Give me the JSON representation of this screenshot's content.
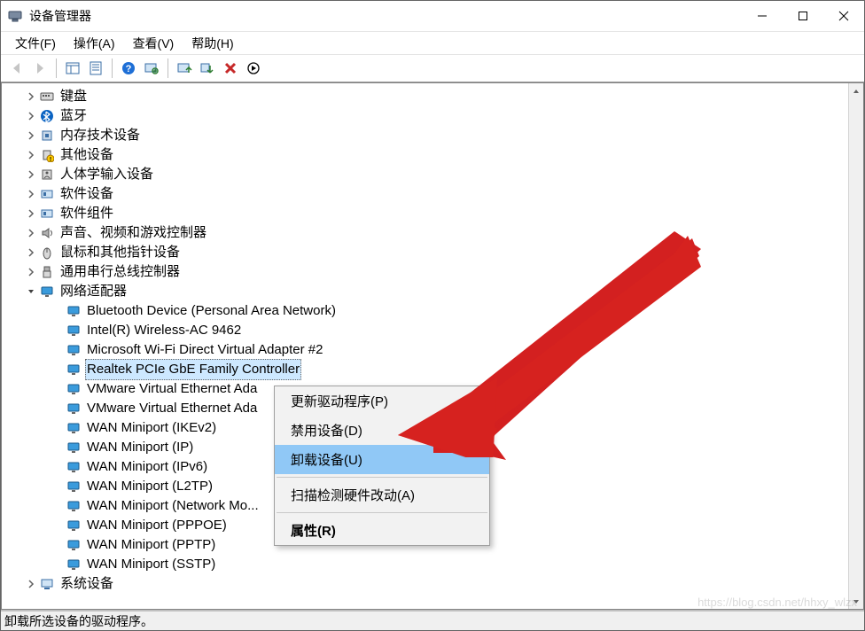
{
  "window": {
    "title": "设备管理器"
  },
  "menu": {
    "file": "文件(F)",
    "action": "操作(A)",
    "view": "查看(V)",
    "help": "帮助(H)"
  },
  "tree": {
    "categories": [
      {
        "id": "keyboard",
        "label": "键盘",
        "icon": "keyboard",
        "expanded": false
      },
      {
        "id": "bluetooth",
        "label": "蓝牙",
        "icon": "bluetooth",
        "expanded": false
      },
      {
        "id": "memory",
        "label": "内存技术设备",
        "icon": "chip",
        "expanded": false
      },
      {
        "id": "other",
        "label": "其他设备",
        "icon": "warn",
        "expanded": false
      },
      {
        "id": "hid",
        "label": "人体学输入设备",
        "icon": "hid",
        "expanded": false
      },
      {
        "id": "software",
        "label": "软件设备",
        "icon": "software",
        "expanded": false
      },
      {
        "id": "swcomp",
        "label": "软件组件",
        "icon": "software",
        "expanded": false
      },
      {
        "id": "sound",
        "label": "声音、视频和游戏控制器",
        "icon": "sound",
        "expanded": false
      },
      {
        "id": "mouse",
        "label": "鼠标和其他指针设备",
        "icon": "mouse",
        "expanded": false
      },
      {
        "id": "usb",
        "label": "通用串行总线控制器",
        "icon": "usb",
        "expanded": false
      },
      {
        "id": "network",
        "label": "网络适配器",
        "icon": "network",
        "expanded": true,
        "children": [
          {
            "label": "Bluetooth Device (Personal Area Network)",
            "selected": false
          },
          {
            "label": "Intel(R) Wireless-AC 9462",
            "selected": false
          },
          {
            "label": "Microsoft Wi-Fi Direct Virtual Adapter #2",
            "selected": false
          },
          {
            "label": "Realtek PCIe GbE Family Controller",
            "selected": true
          },
          {
            "label": "VMware Virtual Ethernet Ada",
            "selected": false
          },
          {
            "label": "VMware Virtual Ethernet Ada",
            "selected": false
          },
          {
            "label": "WAN Miniport (IKEv2)",
            "selected": false
          },
          {
            "label": "WAN Miniport (IP)",
            "selected": false
          },
          {
            "label": "WAN Miniport (IPv6)",
            "selected": false
          },
          {
            "label": "WAN Miniport (L2TP)",
            "selected": false
          },
          {
            "label": "WAN Miniport (Network Mo...",
            "selected": false
          },
          {
            "label": "WAN Miniport (PPPOE)",
            "selected": false
          },
          {
            "label": "WAN Miniport (PPTP)",
            "selected": false
          },
          {
            "label": "WAN Miniport (SSTP)",
            "selected": false
          }
        ]
      },
      {
        "id": "system",
        "label": "系统设备",
        "icon": "system",
        "expanded": false
      }
    ]
  },
  "context_menu": {
    "update_driver": "更新驱动程序(P)",
    "disable": "禁用设备(D)",
    "uninstall": "卸载设备(U)",
    "scan": "扫描检测硬件改动(A)",
    "properties": "属性(R)"
  },
  "status_bar": {
    "text": "卸载所选设备的驱动程序。"
  },
  "watermark": "https://blog.csdn.net/hhxy_wlzx"
}
